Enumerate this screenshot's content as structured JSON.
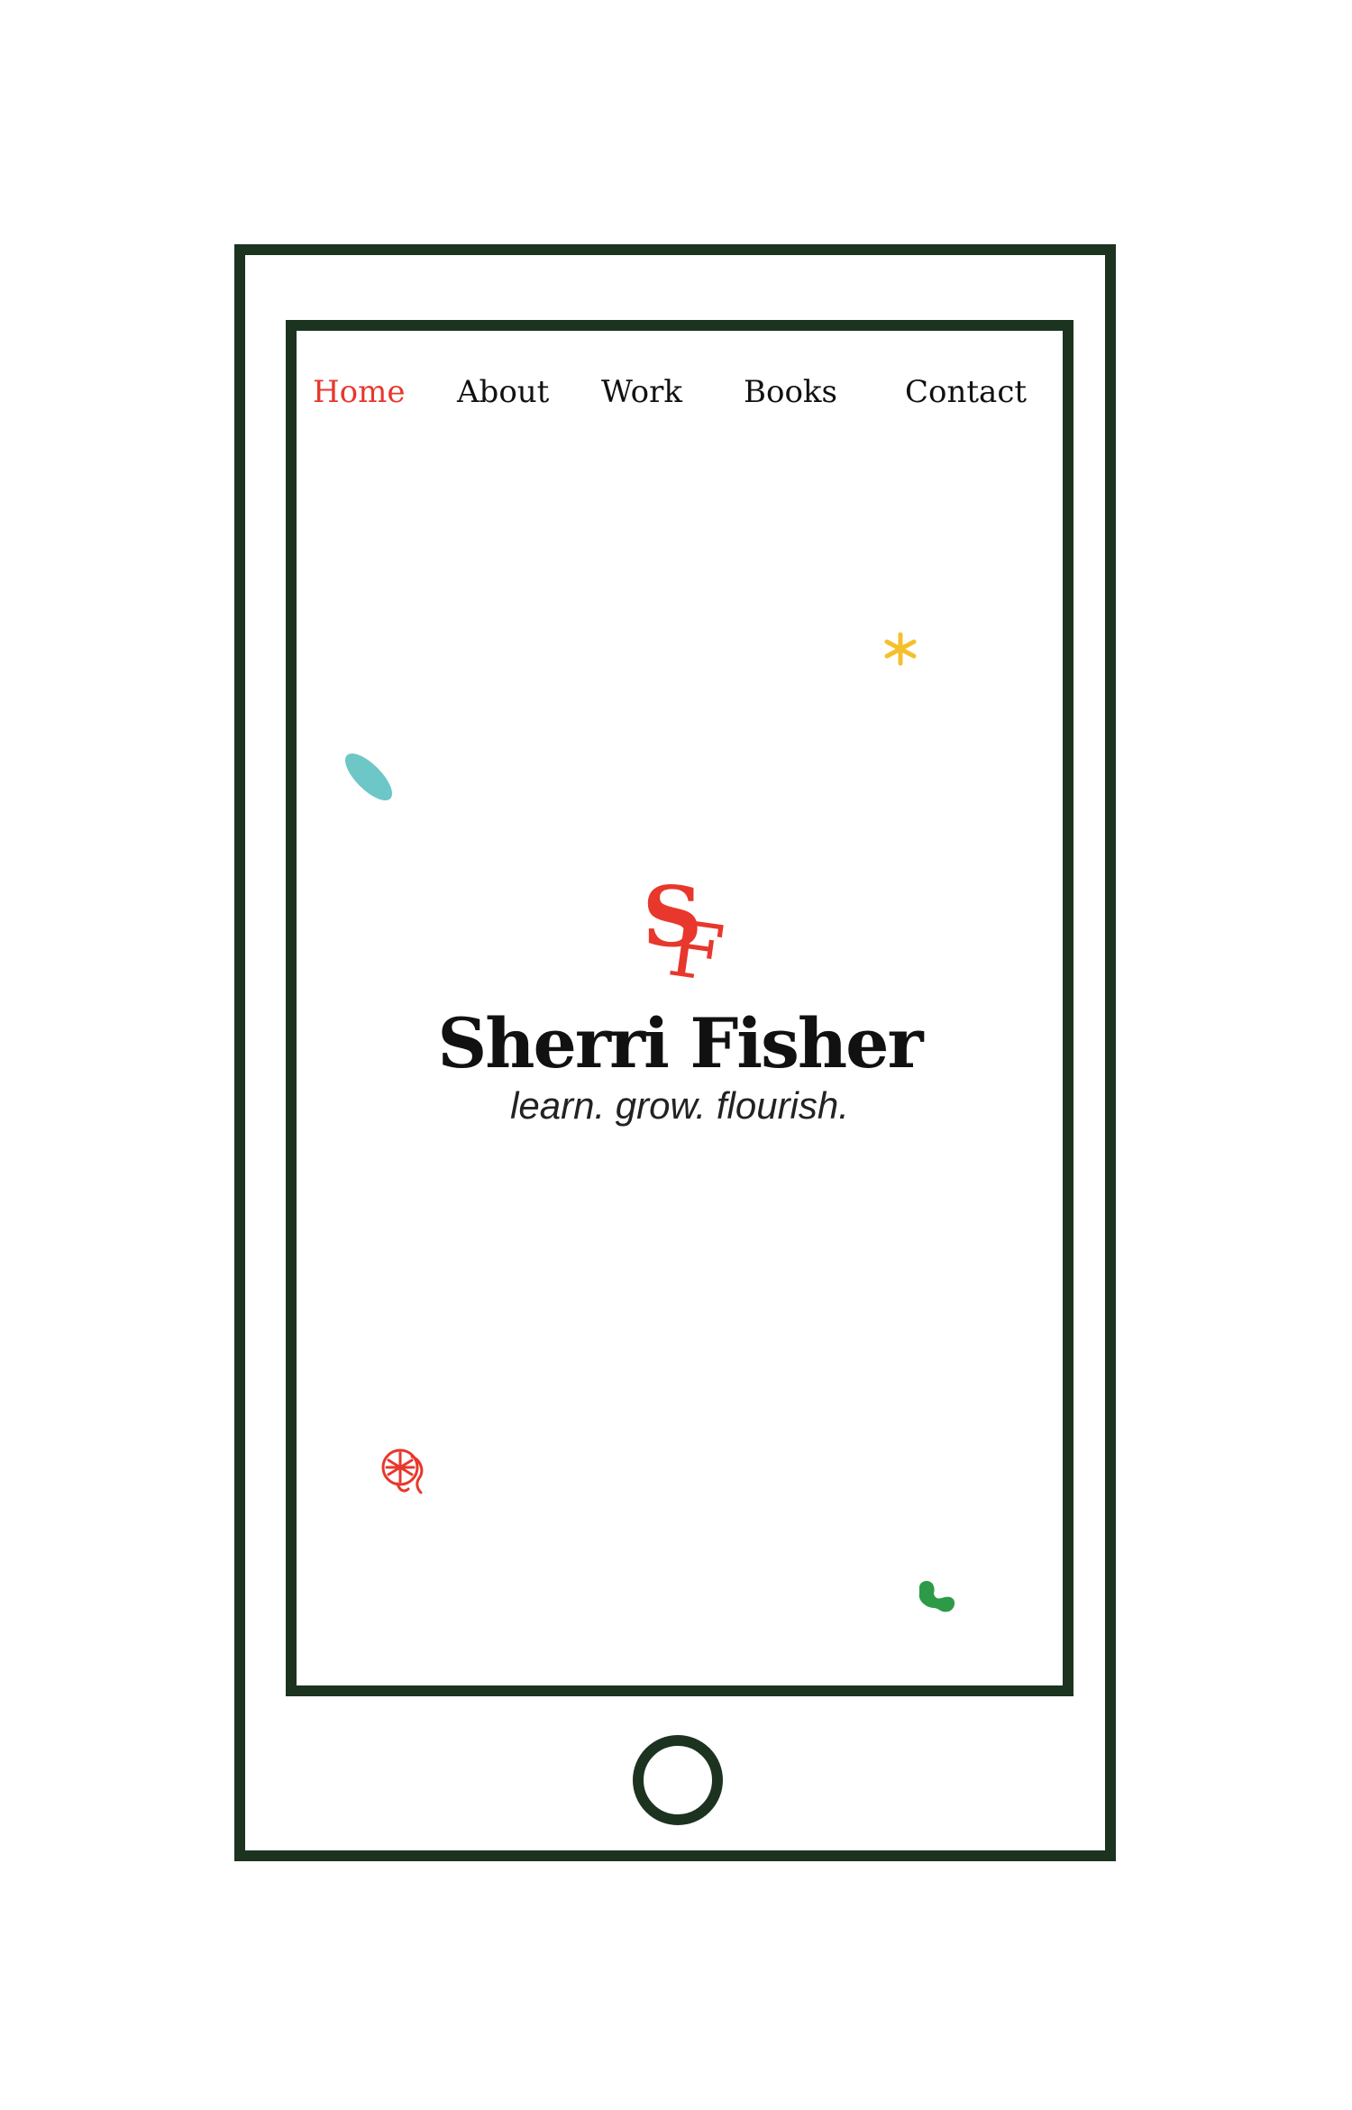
{
  "nav": {
    "items": [
      {
        "label": "Home",
        "active": true
      },
      {
        "label": "About",
        "active": false
      },
      {
        "label": "Work",
        "active": false
      },
      {
        "label": "Books",
        "active": false
      },
      {
        "label": "Contact",
        "active": false
      }
    ]
  },
  "hero": {
    "monogram": "SF",
    "name": "Sherri Fisher",
    "tagline": "learn. grow. flourish."
  },
  "colors": {
    "frame": "#1c3320",
    "accent_red": "#e8372c",
    "teal": "#6cc7c6",
    "yellow": "#f5c02c",
    "green": "#2d9a48"
  },
  "decorations": [
    "yellow-asterisk-icon",
    "teal-brushstroke-icon",
    "red-doodle-flower-icon",
    "green-blob-icon"
  ]
}
